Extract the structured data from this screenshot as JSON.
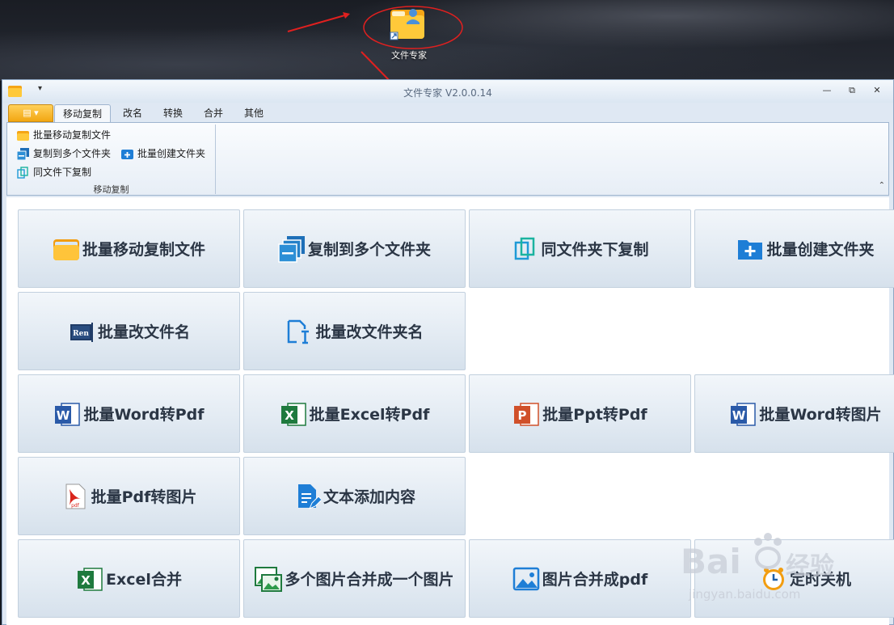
{
  "desktop": {
    "icon_label": "文件专家"
  },
  "window": {
    "title": "文件专家 V2.0.0.14",
    "quick_access": "▾",
    "controls": {
      "minimize": "—",
      "restore": "⧉",
      "close": "✕"
    }
  },
  "tabs": [
    {
      "label": "移动复制",
      "active": true
    },
    {
      "label": "改名"
    },
    {
      "label": "转换"
    },
    {
      "label": "合并"
    },
    {
      "label": "其他"
    }
  ],
  "file_menu": {
    "label": "▤ ▾"
  },
  "ribbon": {
    "items": [
      {
        "label": "批量移动复制文件",
        "icon": "folder-icon"
      },
      {
        "label": "复制到多个文件夹",
        "icon": "copy-multi-icon"
      },
      {
        "label": "批量创建文件夹",
        "icon": "add-folder-icon"
      },
      {
        "label": "同文件下复制",
        "icon": "copy-icon"
      }
    ],
    "group_label": "移动复制",
    "collapse": "⌃"
  },
  "tiles": [
    {
      "label": "批量移动复制文件",
      "icon": "folder-icon"
    },
    {
      "label": "复制到多个文件夹",
      "icon": "copy-multi-icon"
    },
    {
      "label": "同文件夹下复制",
      "icon": "copy-icon"
    },
    {
      "label": "批量创建文件夹",
      "icon": "add-folder-icon"
    },
    {
      "label": "批量改文件名",
      "icon": "rename-icon"
    },
    {
      "label": "批量改文件夹名",
      "icon": "rename-folder-icon"
    },
    {
      "label": "批量Word转Pdf",
      "icon": "word-icon"
    },
    {
      "label": "批量Excel转Pdf",
      "icon": "excel-icon"
    },
    {
      "label": "批量Ppt转Pdf",
      "icon": "ppt-icon"
    },
    {
      "label": "批量Word转图片",
      "icon": "word-icon"
    },
    {
      "label": "批量Pdf转图片",
      "icon": "pdf-icon"
    },
    {
      "label": "文本添加内容",
      "icon": "text-edit-icon"
    },
    {
      "label": "Excel合并",
      "icon": "excel-icon"
    },
    {
      "label": "多个图片合并成一个图片",
      "icon": "images-icon"
    },
    {
      "label": "图片合并成pdf",
      "icon": "image-icon"
    },
    {
      "label": "定时关机",
      "icon": "clock-icon"
    }
  ],
  "watermark": {
    "brand": "Bai",
    "brand_suffix": "经验",
    "url": "jingyan.baidu.com"
  },
  "colors": {
    "accent": "#f2a712",
    "tile_text": "#2b3645",
    "window_bg": "#dfe8f3",
    "annotation": "#e0201f"
  }
}
